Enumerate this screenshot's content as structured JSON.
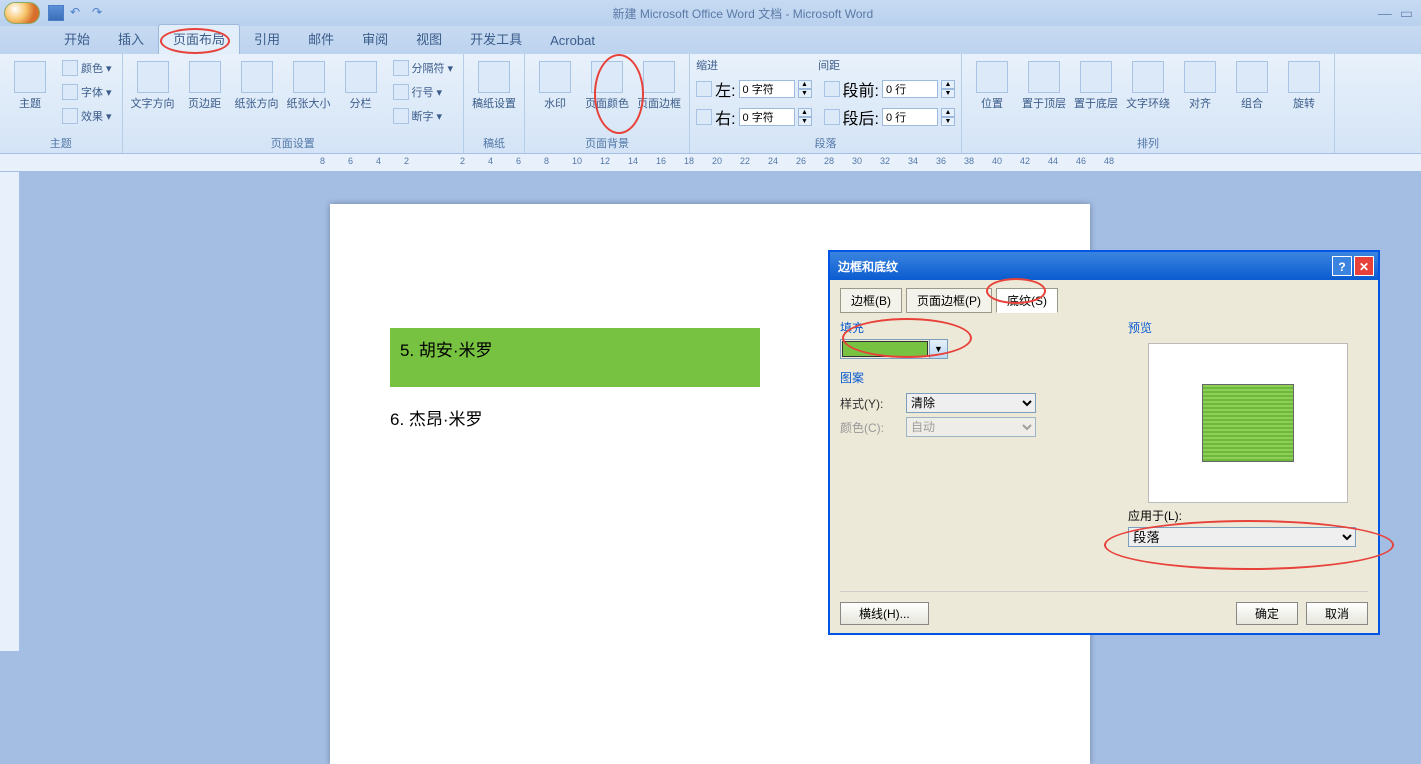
{
  "title": "新建 Microsoft Office Word 文档 - Microsoft Word",
  "tabs": [
    "开始",
    "插入",
    "页面布局",
    "引用",
    "邮件",
    "审阅",
    "视图",
    "开发工具",
    "Acrobat"
  ],
  "active_tab": 2,
  "ribbon": {
    "theme": {
      "label": "主题",
      "btn": "主题",
      "colors": "颜色",
      "fonts": "字体",
      "effects": "效果"
    },
    "page_setup": {
      "label": "页面设置",
      "text_dir": "文字方向",
      "margins": "页边距",
      "orient": "纸张方向",
      "size": "纸张大小",
      "columns": "分栏",
      "breaks": "分隔符",
      "lineno": "行号",
      "hyphen": "断字"
    },
    "stationery": {
      "label": "稿纸",
      "btn": "稿纸设置"
    },
    "page_bg": {
      "label": "页面背景",
      "watermark": "水印",
      "color": "页面颜色",
      "borders": "页面边框"
    },
    "paragraph": {
      "label": "段落",
      "indent": "缩进",
      "left": "左:",
      "right": "右:",
      "spacing": "间距",
      "before": "段前:",
      "after": "段后:",
      "v0": "0 字符",
      "v1": "0 字符",
      "v2": "0 行",
      "v3": "0 行"
    },
    "arrange": {
      "label": "排列",
      "position": "位置",
      "front": "置于顶层",
      "back": "置于底层",
      "wrap": "文字环绕",
      "align": "对齐",
      "group": "组合",
      "rotate": "旋转"
    }
  },
  "doc": {
    "line1": "5. 胡安·米罗",
    "line2": "6. 杰昂·米罗"
  },
  "dialog": {
    "title": "边框和底纹",
    "tabs": [
      "边框(B)",
      "页面边框(P)",
      "底纹(S)"
    ],
    "active_tab": 2,
    "fill_label": "填充",
    "pattern_label": "图案",
    "style": "样式(Y):",
    "style_val": "清除",
    "color": "颜色(C):",
    "color_val": "自动",
    "preview": "预览",
    "apply_to": "应用于(L):",
    "apply_val": "段落",
    "hline": "横线(H)...",
    "ok": "确定",
    "cancel": "取消"
  },
  "ruler_ticks": [
    8,
    6,
    4,
    2,
    "",
    2,
    4,
    6,
    8,
    10,
    12,
    14,
    16,
    18,
    20,
    22,
    24,
    26,
    28,
    30,
    32,
    34,
    36,
    38,
    40,
    42,
    44,
    46,
    48
  ]
}
